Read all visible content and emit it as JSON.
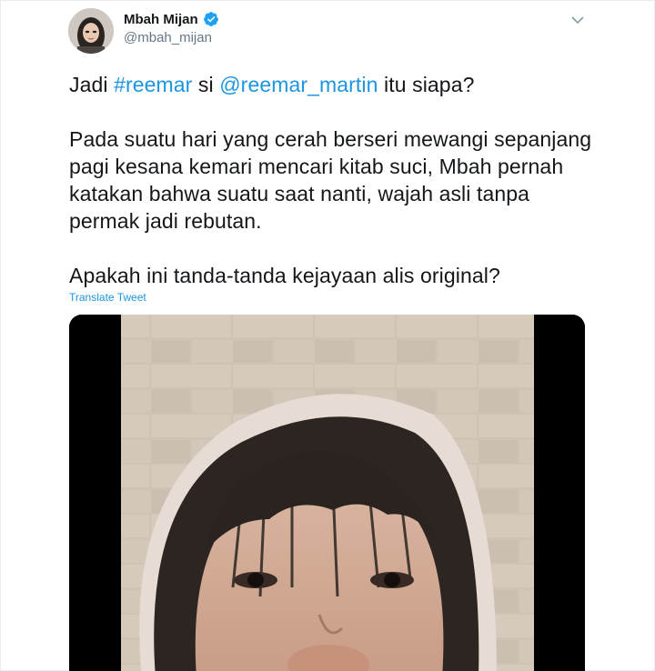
{
  "tweet": {
    "display_name": "Mbah Mijan",
    "handle": "@mbah_mijan",
    "line1": {
      "pre": "Jadi ",
      "hashtag": "#reemar",
      "mid": " si ",
      "mention": "@reemar_martin",
      "post": " itu siapa?"
    },
    "para2": [
      "Pada suatu hari yang cerah berseri mewangi sepanjang",
      "pagi kesana kemari mencari kitab suci, Mbah pernah",
      "katakan bahwa suatu saat nanti, wajah asli tanpa",
      "permak jadi rebutan."
    ],
    "para3": "Apakah ini tanda-tanda kejayaan alis original?",
    "translate_label": "Translate Tweet"
  },
  "icons": {
    "verified": "verified-badge-icon",
    "caret": "chevron-down-icon"
  },
  "colors": {
    "link": "#1b95e0",
    "verified": "#1da1f2",
    "handle": "#657786",
    "text": "#14171a"
  }
}
